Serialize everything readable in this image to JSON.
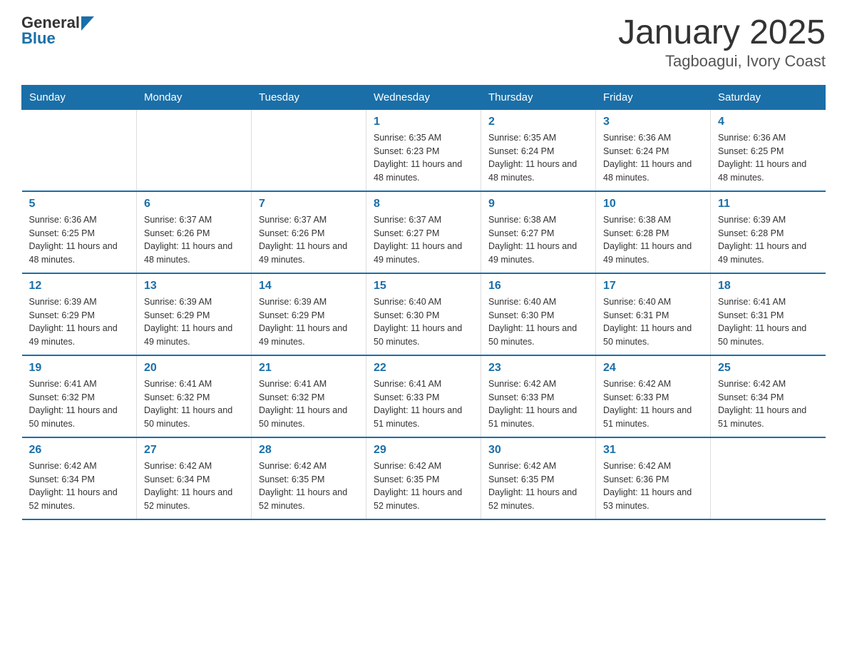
{
  "logo": {
    "general": "General",
    "blue": "Blue"
  },
  "title": "January 2025",
  "subtitle": "Tagboagui, Ivory Coast",
  "days_of_week": [
    "Sunday",
    "Monday",
    "Tuesday",
    "Wednesday",
    "Thursday",
    "Friday",
    "Saturday"
  ],
  "weeks": [
    [
      {
        "day": "",
        "info": ""
      },
      {
        "day": "",
        "info": ""
      },
      {
        "day": "",
        "info": ""
      },
      {
        "day": "1",
        "info": "Sunrise: 6:35 AM\nSunset: 6:23 PM\nDaylight: 11 hours and 48 minutes."
      },
      {
        "day": "2",
        "info": "Sunrise: 6:35 AM\nSunset: 6:24 PM\nDaylight: 11 hours and 48 minutes."
      },
      {
        "day": "3",
        "info": "Sunrise: 6:36 AM\nSunset: 6:24 PM\nDaylight: 11 hours and 48 minutes."
      },
      {
        "day": "4",
        "info": "Sunrise: 6:36 AM\nSunset: 6:25 PM\nDaylight: 11 hours and 48 minutes."
      }
    ],
    [
      {
        "day": "5",
        "info": "Sunrise: 6:36 AM\nSunset: 6:25 PM\nDaylight: 11 hours and 48 minutes."
      },
      {
        "day": "6",
        "info": "Sunrise: 6:37 AM\nSunset: 6:26 PM\nDaylight: 11 hours and 48 minutes."
      },
      {
        "day": "7",
        "info": "Sunrise: 6:37 AM\nSunset: 6:26 PM\nDaylight: 11 hours and 49 minutes."
      },
      {
        "day": "8",
        "info": "Sunrise: 6:37 AM\nSunset: 6:27 PM\nDaylight: 11 hours and 49 minutes."
      },
      {
        "day": "9",
        "info": "Sunrise: 6:38 AM\nSunset: 6:27 PM\nDaylight: 11 hours and 49 minutes."
      },
      {
        "day": "10",
        "info": "Sunrise: 6:38 AM\nSunset: 6:28 PM\nDaylight: 11 hours and 49 minutes."
      },
      {
        "day": "11",
        "info": "Sunrise: 6:39 AM\nSunset: 6:28 PM\nDaylight: 11 hours and 49 minutes."
      }
    ],
    [
      {
        "day": "12",
        "info": "Sunrise: 6:39 AM\nSunset: 6:29 PM\nDaylight: 11 hours and 49 minutes."
      },
      {
        "day": "13",
        "info": "Sunrise: 6:39 AM\nSunset: 6:29 PM\nDaylight: 11 hours and 49 minutes."
      },
      {
        "day": "14",
        "info": "Sunrise: 6:39 AM\nSunset: 6:29 PM\nDaylight: 11 hours and 49 minutes."
      },
      {
        "day": "15",
        "info": "Sunrise: 6:40 AM\nSunset: 6:30 PM\nDaylight: 11 hours and 50 minutes."
      },
      {
        "day": "16",
        "info": "Sunrise: 6:40 AM\nSunset: 6:30 PM\nDaylight: 11 hours and 50 minutes."
      },
      {
        "day": "17",
        "info": "Sunrise: 6:40 AM\nSunset: 6:31 PM\nDaylight: 11 hours and 50 minutes."
      },
      {
        "day": "18",
        "info": "Sunrise: 6:41 AM\nSunset: 6:31 PM\nDaylight: 11 hours and 50 minutes."
      }
    ],
    [
      {
        "day": "19",
        "info": "Sunrise: 6:41 AM\nSunset: 6:32 PM\nDaylight: 11 hours and 50 minutes."
      },
      {
        "day": "20",
        "info": "Sunrise: 6:41 AM\nSunset: 6:32 PM\nDaylight: 11 hours and 50 minutes."
      },
      {
        "day": "21",
        "info": "Sunrise: 6:41 AM\nSunset: 6:32 PM\nDaylight: 11 hours and 50 minutes."
      },
      {
        "day": "22",
        "info": "Sunrise: 6:41 AM\nSunset: 6:33 PM\nDaylight: 11 hours and 51 minutes."
      },
      {
        "day": "23",
        "info": "Sunrise: 6:42 AM\nSunset: 6:33 PM\nDaylight: 11 hours and 51 minutes."
      },
      {
        "day": "24",
        "info": "Sunrise: 6:42 AM\nSunset: 6:33 PM\nDaylight: 11 hours and 51 minutes."
      },
      {
        "day": "25",
        "info": "Sunrise: 6:42 AM\nSunset: 6:34 PM\nDaylight: 11 hours and 51 minutes."
      }
    ],
    [
      {
        "day": "26",
        "info": "Sunrise: 6:42 AM\nSunset: 6:34 PM\nDaylight: 11 hours and 52 minutes."
      },
      {
        "day": "27",
        "info": "Sunrise: 6:42 AM\nSunset: 6:34 PM\nDaylight: 11 hours and 52 minutes."
      },
      {
        "day": "28",
        "info": "Sunrise: 6:42 AM\nSunset: 6:35 PM\nDaylight: 11 hours and 52 minutes."
      },
      {
        "day": "29",
        "info": "Sunrise: 6:42 AM\nSunset: 6:35 PM\nDaylight: 11 hours and 52 minutes."
      },
      {
        "day": "30",
        "info": "Sunrise: 6:42 AM\nSunset: 6:35 PM\nDaylight: 11 hours and 52 minutes."
      },
      {
        "day": "31",
        "info": "Sunrise: 6:42 AM\nSunset: 6:36 PM\nDaylight: 11 hours and 53 minutes."
      },
      {
        "day": "",
        "info": ""
      }
    ]
  ]
}
